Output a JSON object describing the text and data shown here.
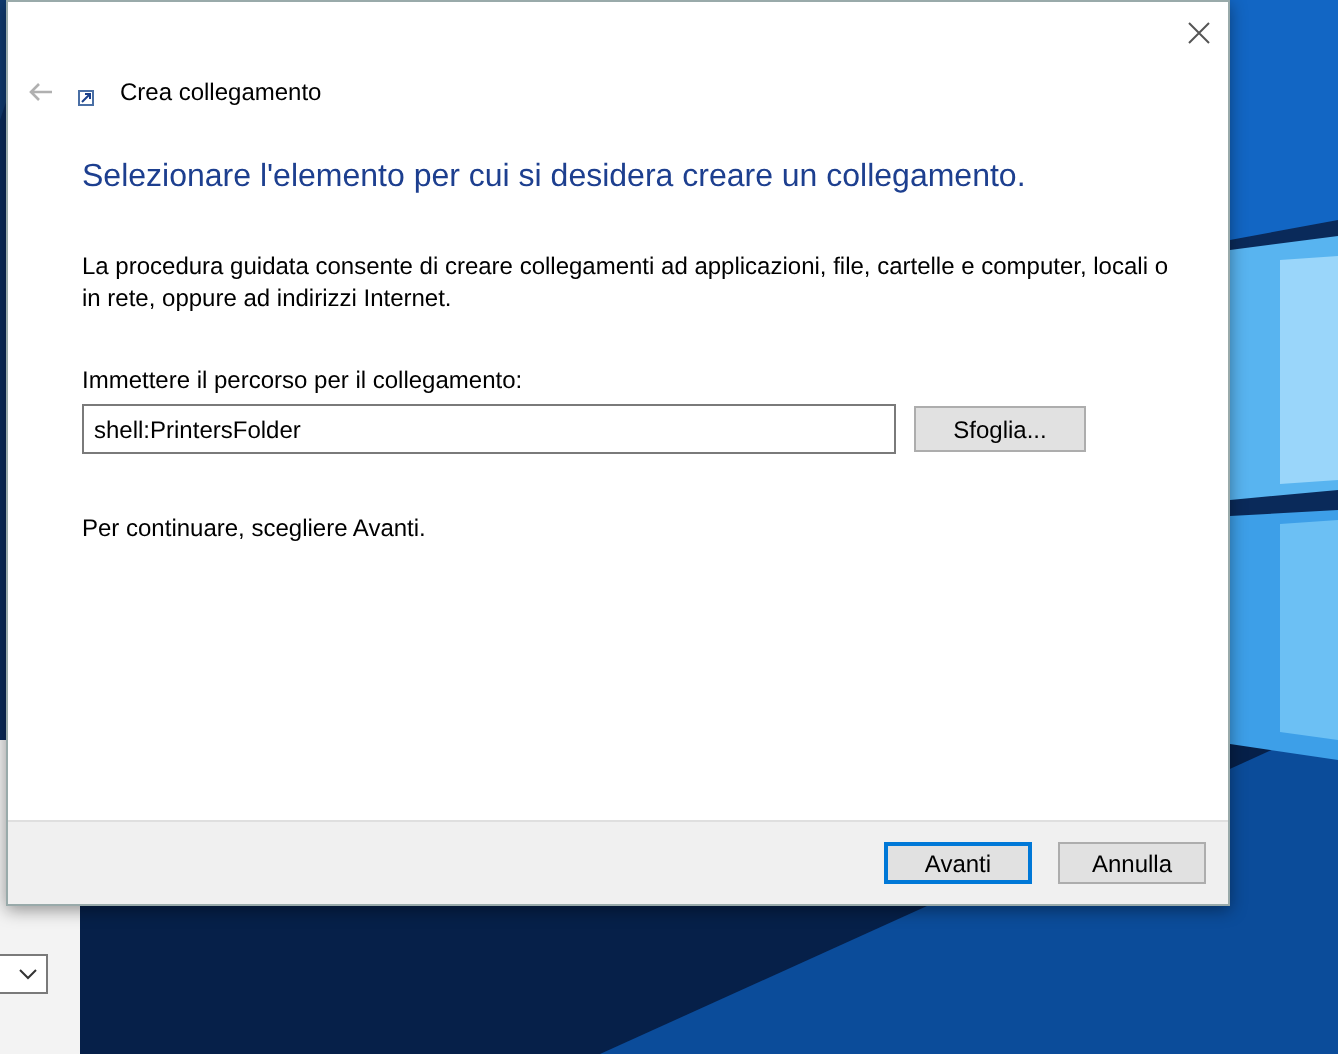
{
  "dialog": {
    "title": "Crea collegamento",
    "heading": "Selezionare l'elemento per cui si desidera creare un collegamento.",
    "description": "La procedura guidata consente di creare collegamenti ad applicazioni, file, cartelle e computer, locali o in rete, oppure ad indirizzi Internet.",
    "path_label": "Immettere il percorso per il collegamento:",
    "path_value": "shell:PrintersFolder",
    "browse_button": "Sfoglia...",
    "hint": "Per continuare, scegliere Avanti.",
    "buttons": [
      {
        "label": "Avanti",
        "selected": true
      },
      {
        "label": "Annulla",
        "selected": false
      }
    ]
  }
}
